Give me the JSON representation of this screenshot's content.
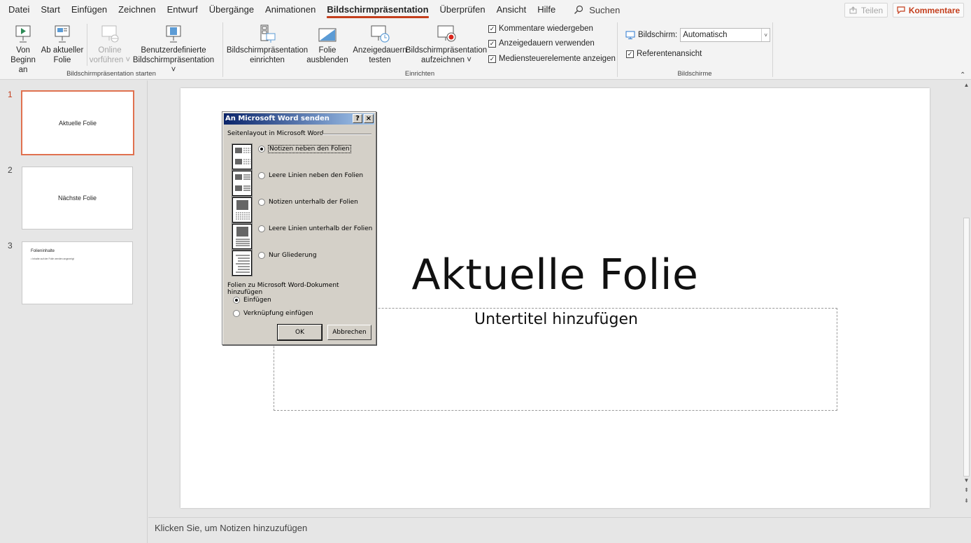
{
  "tabs": [
    "Datei",
    "Start",
    "Einfügen",
    "Zeichnen",
    "Entwurf",
    "Übergänge",
    "Animationen",
    "Bildschirmpräsentation",
    "Überprüfen",
    "Ansicht",
    "Hilfe"
  ],
  "active_tab": "Bildschirmpräsentation",
  "search_label": "Suchen",
  "share_label": "Teilen",
  "comments_label": "Kommentare",
  "accent_color": "#c43e1c",
  "ribbon": {
    "from_start": {
      "line1": "Von",
      "line2": "Beginn an"
    },
    "from_current": {
      "line1": "Ab aktueller",
      "line2": "Folie"
    },
    "online": {
      "line1": "Online",
      "line2": "vorführen ˅"
    },
    "custom": {
      "line1": "Benutzerdefinierte",
      "line2": "Bildschirmpräsentation ˅"
    },
    "group_start": "Bildschirmpräsentation starten",
    "setup": {
      "line1": "Bildschirmpräsentation",
      "line2": "einrichten"
    },
    "hide": {
      "line1": "Folie",
      "line2": "ausblenden"
    },
    "rehearse": {
      "line1": "Anzeigedauern",
      "line2": "testen"
    },
    "record": {
      "line1": "Bildschirmpräsentation",
      "line2": "aufzeichnen ˅"
    },
    "chk_comments": "Kommentare wiedergeben",
    "chk_timings": "Anzeigedauern verwenden",
    "chk_media": "Mediensteuerelemente anzeigen",
    "group_setup": "Einrichten",
    "screen_label": "Bildschirm:",
    "screen_value": "Automatisch",
    "chk_presenter": "Referentenansicht",
    "group_screens": "Bildschirme"
  },
  "thumbnails": [
    {
      "num": "1",
      "text": "Aktuelle Folie"
    },
    {
      "num": "2",
      "text": "Nächste Folie"
    },
    {
      "num": "3",
      "title": "Folieninhalte",
      "bullet": "• Inhalte auf der Folie werden angezeigt"
    }
  ],
  "slide": {
    "title": "Aktuelle Folie",
    "subtitle": "Untertitel hinzufügen"
  },
  "notes_placeholder": "Klicken Sie, um Notizen hinzuzufügen",
  "dialog": {
    "title": "An Microsoft Word senden",
    "help": "?",
    "close": "×",
    "section_layout": "Seitenlayout in Microsoft Word",
    "options": [
      "Notizen neben den Folien",
      "Leere Linien neben den Folien",
      "Notizen unterhalb der Folien",
      "Leere Linien unterhalb der Folien",
      "Nur Gliederung"
    ],
    "section_add": "Folien zu Microsoft Word-Dokument hinzufügen",
    "add_options": [
      "Einfügen",
      "Verknüpfung einfügen"
    ],
    "ok": "OK",
    "cancel": "Abbrechen"
  }
}
